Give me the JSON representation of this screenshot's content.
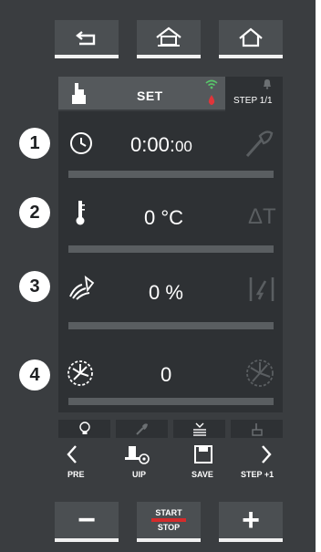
{
  "header": {
    "mode_label": "SET",
    "step_label": "STEP 1/1"
  },
  "rows": [
    {
      "number": "1",
      "value_main": "0:00:",
      "value_small": "00",
      "icon": "timer-icon",
      "side_icon": "core-probe-icon"
    },
    {
      "number": "2",
      "value": "0 °C",
      "icon": "thermometer-icon",
      "side_icon": "delta-t-icon",
      "side_text": "ΔT"
    },
    {
      "number": "3",
      "value": "0 %",
      "icon": "humidity-icon",
      "side_icon": "damper-icon"
    },
    {
      "number": "4",
      "value": "0",
      "icon": "fan-speed-icon",
      "side_icon": "fan-icon"
    }
  ],
  "nav": {
    "pre": "PRE",
    "uip": "UIP",
    "save": "SAVE",
    "step_next": "STEP +1"
  },
  "bottom": {
    "minus": "−",
    "start": "START",
    "stop": "STOP",
    "plus": "+"
  }
}
